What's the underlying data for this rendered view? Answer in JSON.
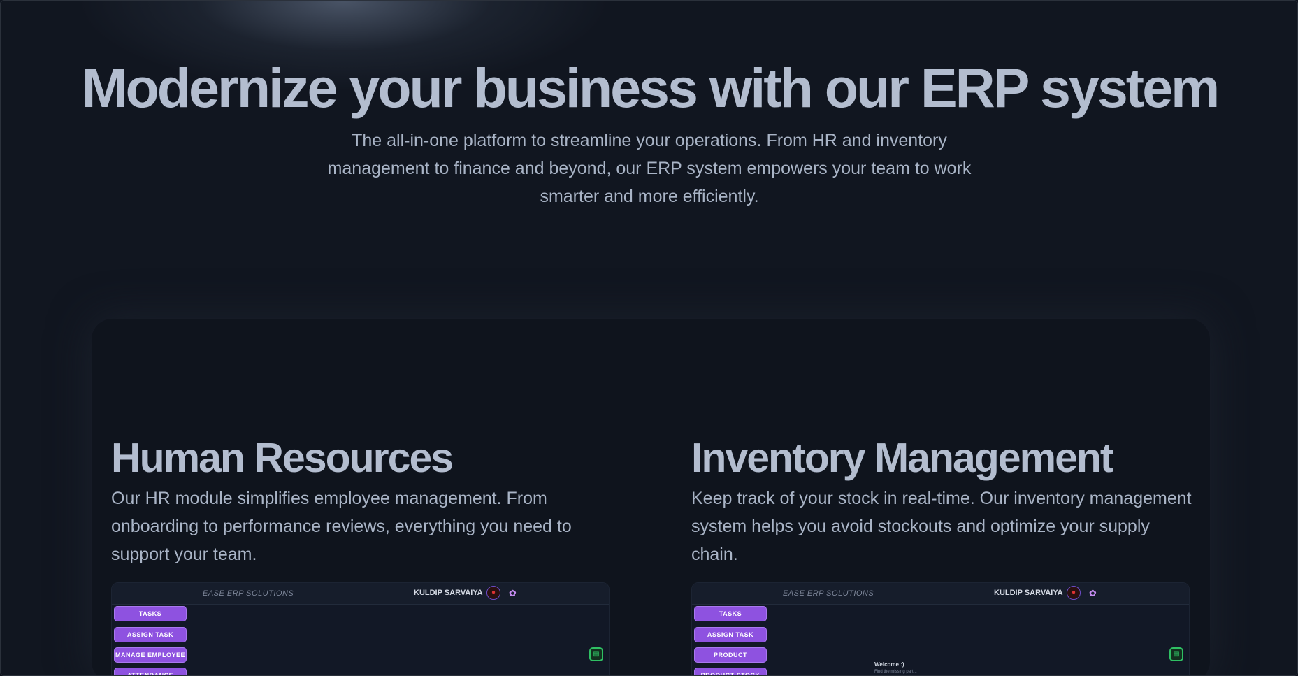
{
  "hero": {
    "title": "Modernize your business with our ERP system",
    "subtitle": "The all-in-one platform to streamline your operations. From HR and inventory management to finance and beyond, our ERP system empowers your team to work smarter and more efficiently."
  },
  "features": [
    {
      "title": "Human Resources",
      "description": "Our HR module simplifies employee management. From onboarding to performance reviews, everything you need to support your team.",
      "preview": {
        "brand": "EASE ERP SOLUTIONS",
        "user": "KULDIP SARVAIYA",
        "menu": [
          "TASKS",
          "ASSIGN TASK",
          "MANAGE EMPLOYEE",
          "ATTENDANCE"
        ]
      }
    },
    {
      "title": "Inventory Management",
      "description": "Keep track of your stock in real-time. Our inventory management system helps you avoid stockouts and optimize your supply chain.",
      "preview": {
        "brand": "EASE ERP SOLUTIONS",
        "user": "KULDIP SARVAIYA",
        "menu": [
          "TASKS",
          "ASSIGN TASK",
          "PRODUCT",
          "PRODUCT STOCK"
        ],
        "welcome": "Welcome :)",
        "welcome_sub": "Find the missing part..."
      }
    }
  ],
  "icons": {
    "avatar": "avatar-icon",
    "bot": "bot-icon",
    "chat": "chat-icon"
  },
  "colors": {
    "background": "#111620",
    "heading": "#b3bdcf",
    "body_text": "#a9b4c6",
    "menu_button": "#8e52e0",
    "chat_icon": "#2fbf63"
  }
}
